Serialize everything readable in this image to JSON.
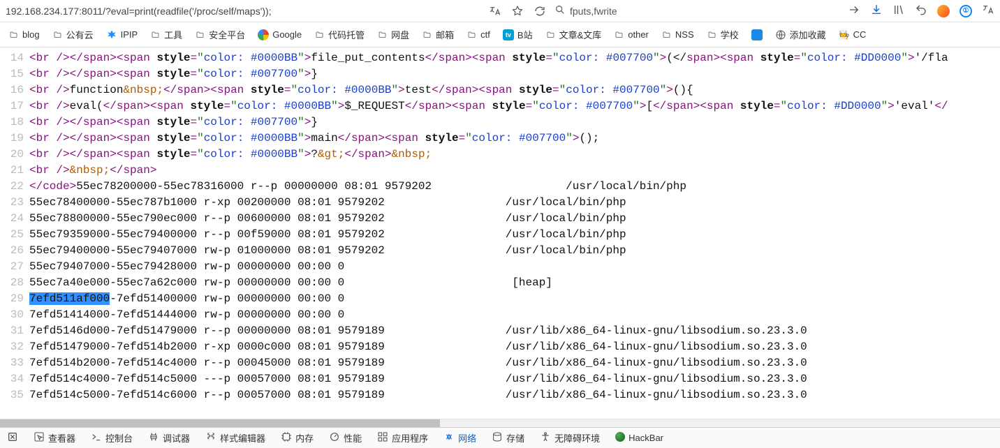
{
  "url": "192.168.234.177:8011/?eval=print(readfile('/proc/self/maps'));",
  "search_query": "fputs,fwrite",
  "bookmarks": [
    {
      "label": "blog",
      "icon": "folder"
    },
    {
      "label": "公有云",
      "icon": "folder"
    },
    {
      "label": "IPIP",
      "icon": "ipip"
    },
    {
      "label": "工具",
      "icon": "folder"
    },
    {
      "label": "安全平台",
      "icon": "folder"
    },
    {
      "label": "Google",
      "icon": "google"
    },
    {
      "label": "代码托管",
      "icon": "folder"
    },
    {
      "label": "网盘",
      "icon": "folder"
    },
    {
      "label": "邮箱",
      "icon": "folder"
    },
    {
      "label": "ctf",
      "icon": "folder"
    },
    {
      "label": "B站",
      "icon": "bili"
    },
    {
      "label": "文章&文库",
      "icon": "folder"
    },
    {
      "label": "other",
      "icon": "folder"
    },
    {
      "label": "NSS",
      "icon": "folder"
    },
    {
      "label": "学校",
      "icon": "folder"
    },
    {
      "label": "",
      "icon": "square"
    },
    {
      "label": "添加收藏",
      "icon": "globe"
    },
    {
      "label": "CC",
      "icon": "chef"
    }
  ],
  "devtools": [
    {
      "label": "查看器",
      "icon": "inspector"
    },
    {
      "label": "控制台",
      "icon": "console"
    },
    {
      "label": "调试器",
      "icon": "debugger"
    },
    {
      "label": "样式编辑器",
      "icon": "style"
    },
    {
      "label": "内存",
      "icon": "memory"
    },
    {
      "label": "性能",
      "icon": "perf"
    },
    {
      "label": "应用程序",
      "icon": "app"
    },
    {
      "label": "网络",
      "icon": "network",
      "active": true
    },
    {
      "label": "存储",
      "icon": "storage"
    },
    {
      "label": "无障碍环境",
      "icon": "a11y"
    },
    {
      "label": "HackBar",
      "icon": "hackbar"
    }
  ],
  "code_lines": [
    {
      "n": 14,
      "segs": [
        {
          "t": "<",
          "c": "c-darkred"
        },
        {
          "t": "br ",
          "c": "c-darkred"
        },
        {
          "t": "/></",
          "c": "c-darkred"
        },
        {
          "t": "span",
          "c": "c-darkred"
        },
        {
          "t": "><",
          "c": "c-darkred"
        },
        {
          "t": "span ",
          "c": "c-darkred"
        },
        {
          "t": "style",
          "c": "c-black",
          "b": true
        },
        {
          "t": "=",
          "c": "c-darkred"
        },
        {
          "t": "\"",
          "c": "c-greenq"
        },
        {
          "t": "color: #0000BB",
          "c": "c-str"
        },
        {
          "t": "\"",
          "c": "c-greenq"
        },
        {
          "t": ">",
          "c": "c-darkred"
        },
        {
          "t": "file_put_contents",
          "c": "c-black"
        },
        {
          "t": "</",
          "c": "c-darkred"
        },
        {
          "t": "span",
          "c": "c-darkred"
        },
        {
          "t": "><",
          "c": "c-darkred"
        },
        {
          "t": "span ",
          "c": "c-darkred"
        },
        {
          "t": "style",
          "c": "c-black",
          "b": true
        },
        {
          "t": "=",
          "c": "c-darkred"
        },
        {
          "t": "\"",
          "c": "c-greenq"
        },
        {
          "t": "color: #007700",
          "c": "c-str"
        },
        {
          "t": "\"",
          "c": "c-greenq"
        },
        {
          "t": ">",
          "c": "c-darkred"
        },
        {
          "t": "(</",
          "c": "c-black"
        },
        {
          "t": "span",
          "c": "c-darkred"
        },
        {
          "t": "><",
          "c": "c-darkred"
        },
        {
          "t": "span ",
          "c": "c-darkred"
        },
        {
          "t": "style",
          "c": "c-black",
          "b": true
        },
        {
          "t": "=",
          "c": "c-darkred"
        },
        {
          "t": "\"",
          "c": "c-greenq"
        },
        {
          "t": "color: #DD0000",
          "c": "c-str"
        },
        {
          "t": "\"",
          "c": "c-greenq"
        },
        {
          "t": ">",
          "c": "c-darkred"
        },
        {
          "t": "'/fla",
          "c": "c-black"
        }
      ]
    },
    {
      "n": 15,
      "segs": [
        {
          "t": "<",
          "c": "c-darkred"
        },
        {
          "t": "br ",
          "c": "c-darkred"
        },
        {
          "t": "/></",
          "c": "c-darkred"
        },
        {
          "t": "span",
          "c": "c-darkred"
        },
        {
          "t": "><",
          "c": "c-darkred"
        },
        {
          "t": "span ",
          "c": "c-darkred"
        },
        {
          "t": "style",
          "c": "c-black",
          "b": true
        },
        {
          "t": "=",
          "c": "c-darkred"
        },
        {
          "t": "\"",
          "c": "c-greenq"
        },
        {
          "t": "color: #007700",
          "c": "c-str"
        },
        {
          "t": "\"",
          "c": "c-greenq"
        },
        {
          "t": ">",
          "c": "c-darkred"
        },
        {
          "t": "}",
          "c": "c-black"
        }
      ]
    },
    {
      "n": 16,
      "segs": [
        {
          "t": "<",
          "c": "c-darkred"
        },
        {
          "t": "br ",
          "c": "c-darkred"
        },
        {
          "t": "/>",
          "c": "c-darkred"
        },
        {
          "t": "function",
          "c": "c-black"
        },
        {
          "t": "&nbsp;",
          "c": "c-amp"
        },
        {
          "t": "</",
          "c": "c-darkred"
        },
        {
          "t": "span",
          "c": "c-darkred"
        },
        {
          "t": "><",
          "c": "c-darkred"
        },
        {
          "t": "span ",
          "c": "c-darkred"
        },
        {
          "t": "style",
          "c": "c-black",
          "b": true
        },
        {
          "t": "=",
          "c": "c-darkred"
        },
        {
          "t": "\"",
          "c": "c-greenq"
        },
        {
          "t": "color: #0000BB",
          "c": "c-str"
        },
        {
          "t": "\"",
          "c": "c-greenq"
        },
        {
          "t": ">",
          "c": "c-darkred"
        },
        {
          "t": "test",
          "c": "c-black"
        },
        {
          "t": "</",
          "c": "c-darkred"
        },
        {
          "t": "span",
          "c": "c-darkred"
        },
        {
          "t": "><",
          "c": "c-darkred"
        },
        {
          "t": "span ",
          "c": "c-darkred"
        },
        {
          "t": "style",
          "c": "c-black",
          "b": true
        },
        {
          "t": "=",
          "c": "c-darkred"
        },
        {
          "t": "\"",
          "c": "c-greenq"
        },
        {
          "t": "color: #007700",
          "c": "c-str"
        },
        {
          "t": "\"",
          "c": "c-greenq"
        },
        {
          "t": ">",
          "c": "c-darkred"
        },
        {
          "t": "(){",
          "c": "c-black"
        }
      ]
    },
    {
      "n": 17,
      "segs": [
        {
          "t": "<",
          "c": "c-darkred"
        },
        {
          "t": "br ",
          "c": "c-darkred"
        },
        {
          "t": "/>",
          "c": "c-darkred"
        },
        {
          "t": "eval(",
          "c": "c-black"
        },
        {
          "t": "</",
          "c": "c-darkred"
        },
        {
          "t": "span",
          "c": "c-darkred"
        },
        {
          "t": "><",
          "c": "c-darkred"
        },
        {
          "t": "span ",
          "c": "c-darkred"
        },
        {
          "t": "style",
          "c": "c-black",
          "b": true
        },
        {
          "t": "=",
          "c": "c-darkred"
        },
        {
          "t": "\"",
          "c": "c-greenq"
        },
        {
          "t": "color: #0000BB",
          "c": "c-str"
        },
        {
          "t": "\"",
          "c": "c-greenq"
        },
        {
          "t": ">",
          "c": "c-darkred"
        },
        {
          "t": "$_REQUEST",
          "c": "c-black"
        },
        {
          "t": "</",
          "c": "c-darkred"
        },
        {
          "t": "span",
          "c": "c-darkred"
        },
        {
          "t": "><",
          "c": "c-darkred"
        },
        {
          "t": "span ",
          "c": "c-darkred"
        },
        {
          "t": "style",
          "c": "c-black",
          "b": true
        },
        {
          "t": "=",
          "c": "c-darkred"
        },
        {
          "t": "\"",
          "c": "c-greenq"
        },
        {
          "t": "color: #007700",
          "c": "c-str"
        },
        {
          "t": "\"",
          "c": "c-greenq"
        },
        {
          "t": ">",
          "c": "c-darkred"
        },
        {
          "t": "[",
          "c": "c-black"
        },
        {
          "t": "</",
          "c": "c-darkred"
        },
        {
          "t": "span",
          "c": "c-darkred"
        },
        {
          "t": "><",
          "c": "c-darkred"
        },
        {
          "t": "span ",
          "c": "c-darkred"
        },
        {
          "t": "style",
          "c": "c-black",
          "b": true
        },
        {
          "t": "=",
          "c": "c-darkred"
        },
        {
          "t": "\"",
          "c": "c-greenq"
        },
        {
          "t": "color: #DD0000",
          "c": "c-str"
        },
        {
          "t": "\"",
          "c": "c-greenq"
        },
        {
          "t": ">",
          "c": "c-darkred"
        },
        {
          "t": "'eval'",
          "c": "c-black"
        },
        {
          "t": "</",
          "c": "c-darkred"
        }
      ]
    },
    {
      "n": 18,
      "segs": [
        {
          "t": "<",
          "c": "c-darkred"
        },
        {
          "t": "br ",
          "c": "c-darkred"
        },
        {
          "t": "/></",
          "c": "c-darkred"
        },
        {
          "t": "span",
          "c": "c-darkred"
        },
        {
          "t": "><",
          "c": "c-darkred"
        },
        {
          "t": "span ",
          "c": "c-darkred"
        },
        {
          "t": "style",
          "c": "c-black",
          "b": true
        },
        {
          "t": "=",
          "c": "c-darkred"
        },
        {
          "t": "\"",
          "c": "c-greenq"
        },
        {
          "t": "color: #007700",
          "c": "c-str"
        },
        {
          "t": "\"",
          "c": "c-greenq"
        },
        {
          "t": ">",
          "c": "c-darkred"
        },
        {
          "t": "}",
          "c": "c-black"
        }
      ]
    },
    {
      "n": 19,
      "segs": [
        {
          "t": "<",
          "c": "c-darkred"
        },
        {
          "t": "br ",
          "c": "c-darkred"
        },
        {
          "t": "/></",
          "c": "c-darkred"
        },
        {
          "t": "span",
          "c": "c-darkred"
        },
        {
          "t": "><",
          "c": "c-darkred"
        },
        {
          "t": "span ",
          "c": "c-darkred"
        },
        {
          "t": "style",
          "c": "c-black",
          "b": true
        },
        {
          "t": "=",
          "c": "c-darkred"
        },
        {
          "t": "\"",
          "c": "c-greenq"
        },
        {
          "t": "color: #0000BB",
          "c": "c-str"
        },
        {
          "t": "\"",
          "c": "c-greenq"
        },
        {
          "t": ">",
          "c": "c-darkred"
        },
        {
          "t": "main",
          "c": "c-black"
        },
        {
          "t": "</",
          "c": "c-darkred"
        },
        {
          "t": "span",
          "c": "c-darkred"
        },
        {
          "t": "><",
          "c": "c-darkred"
        },
        {
          "t": "span ",
          "c": "c-darkred"
        },
        {
          "t": "style",
          "c": "c-black",
          "b": true
        },
        {
          "t": "=",
          "c": "c-darkred"
        },
        {
          "t": "\"",
          "c": "c-greenq"
        },
        {
          "t": "color: #007700",
          "c": "c-str"
        },
        {
          "t": "\"",
          "c": "c-greenq"
        },
        {
          "t": ">",
          "c": "c-darkred"
        },
        {
          "t": "();",
          "c": "c-black"
        }
      ]
    },
    {
      "n": 20,
      "segs": [
        {
          "t": "<",
          "c": "c-darkred"
        },
        {
          "t": "br ",
          "c": "c-darkred"
        },
        {
          "t": "/></",
          "c": "c-darkred"
        },
        {
          "t": "span",
          "c": "c-darkred"
        },
        {
          "t": "><",
          "c": "c-darkred"
        },
        {
          "t": "span ",
          "c": "c-darkred"
        },
        {
          "t": "style",
          "c": "c-black",
          "b": true
        },
        {
          "t": "=",
          "c": "c-darkred"
        },
        {
          "t": "\"",
          "c": "c-greenq"
        },
        {
          "t": "color: #0000BB",
          "c": "c-str"
        },
        {
          "t": "\"",
          "c": "c-greenq"
        },
        {
          "t": ">",
          "c": "c-darkred"
        },
        {
          "t": "?",
          "c": "c-black"
        },
        {
          "t": "&gt;",
          "c": "c-amp"
        },
        {
          "t": "</",
          "c": "c-darkred"
        },
        {
          "t": "span",
          "c": "c-darkred"
        },
        {
          "t": ">",
          "c": "c-darkred"
        },
        {
          "t": "&nbsp;",
          "c": "c-amp"
        }
      ]
    },
    {
      "n": 21,
      "segs": [
        {
          "t": "<",
          "c": "c-darkred"
        },
        {
          "t": "br ",
          "c": "c-darkred"
        },
        {
          "t": "/>",
          "c": "c-darkred"
        },
        {
          "t": "&nbsp;",
          "c": "c-amp"
        },
        {
          "t": "</",
          "c": "c-darkred"
        },
        {
          "t": "span",
          "c": "c-darkred"
        },
        {
          "t": ">",
          "c": "c-darkred"
        }
      ]
    },
    {
      "n": 22,
      "segs": [
        {
          "t": "</",
          "c": "c-darkred"
        },
        {
          "t": "code",
          "c": "c-darkred"
        },
        {
          "t": ">",
          "c": "c-darkred"
        },
        {
          "t": "55ec78200000-55ec78316000 r--p 00000000 08:01 9579202                    /usr/local/bin/php",
          "c": "c-black"
        }
      ]
    },
    {
      "n": 23,
      "segs": [
        {
          "t": "55ec78400000-55ec787b1000 r-xp 00200000 08:01 9579202                  /usr/local/bin/php",
          "c": "c-black"
        }
      ]
    },
    {
      "n": 24,
      "segs": [
        {
          "t": "55ec78800000-55ec790ec000 r--p 00600000 08:01 9579202                  /usr/local/bin/php",
          "c": "c-black"
        }
      ]
    },
    {
      "n": 25,
      "segs": [
        {
          "t": "55ec79359000-55ec79400000 r--p 00f59000 08:01 9579202                  /usr/local/bin/php",
          "c": "c-black"
        }
      ]
    },
    {
      "n": 26,
      "segs": [
        {
          "t": "55ec79400000-55ec79407000 rw-p 01000000 08:01 9579202                  /usr/local/bin/php",
          "c": "c-black"
        }
      ]
    },
    {
      "n": 27,
      "segs": [
        {
          "t": "55ec79407000-55ec79428000 rw-p 00000000 00:00 0",
          "c": "c-black"
        }
      ]
    },
    {
      "n": 28,
      "segs": [
        {
          "t": "55ec7a40e000-55ec7a62c000 rw-p 00000000 00:00 0                         [heap]",
          "c": "c-black"
        }
      ]
    },
    {
      "n": 29,
      "segs": [
        {
          "t": "7efd511af000",
          "c": "c-black",
          "sel": true
        },
        {
          "t": "-7efd51400000 rw-p 00000000 00:00 0",
          "c": "c-black"
        }
      ]
    },
    {
      "n": 30,
      "segs": [
        {
          "t": "7efd51414000-7efd51444000 rw-p 00000000 00:00 0",
          "c": "c-black"
        }
      ]
    },
    {
      "n": 31,
      "segs": [
        {
          "t": "7efd5146d000-7efd51479000 r--p 00000000 08:01 9579189                  /usr/lib/x86_64-linux-gnu/libsodium.so.23.3.0",
          "c": "c-black"
        }
      ]
    },
    {
      "n": 32,
      "segs": [
        {
          "t": "7efd51479000-7efd514b2000 r-xp 0000c000 08:01 9579189                  /usr/lib/x86_64-linux-gnu/libsodium.so.23.3.0",
          "c": "c-black"
        }
      ]
    },
    {
      "n": 33,
      "segs": [
        {
          "t": "7efd514b2000-7efd514c4000 r--p 00045000 08:01 9579189                  /usr/lib/x86_64-linux-gnu/libsodium.so.23.3.0",
          "c": "c-black"
        }
      ]
    },
    {
      "n": 34,
      "segs": [
        {
          "t": "7efd514c4000-7efd514c5000 ---p 00057000 08:01 9579189                  /usr/lib/x86_64-linux-gnu/libsodium.so.23.3.0",
          "c": "c-black"
        }
      ]
    },
    {
      "n": 35,
      "segs": [
        {
          "t": "7efd514c5000-7efd514c6000 r--p 00057000 08:01 9579189                  /usr/lib/x86_64-linux-gnu/libsodium.so.23.3.0",
          "c": "c-black"
        }
      ]
    }
  ]
}
